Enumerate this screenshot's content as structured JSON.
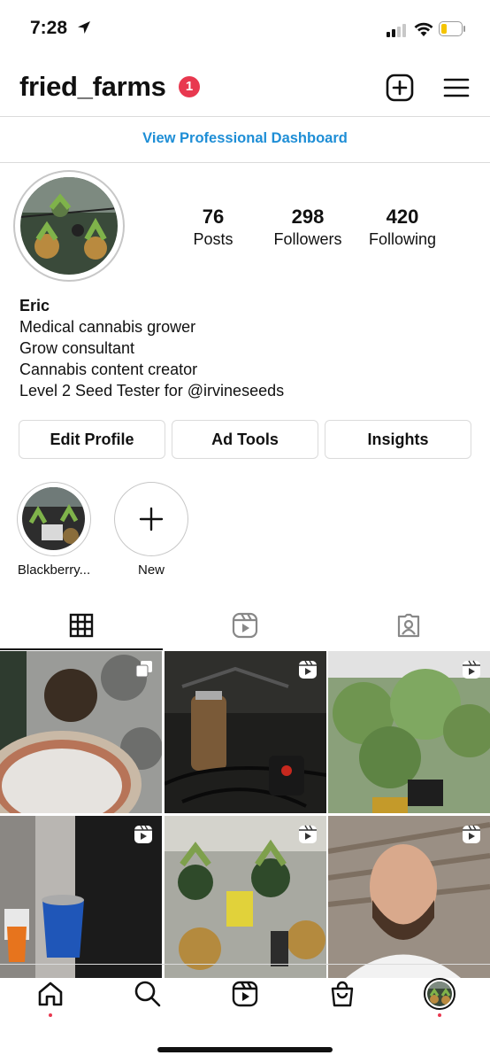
{
  "status": {
    "time": "7:28"
  },
  "header": {
    "username": "fried_farms",
    "notification_count": "1"
  },
  "dashboard_link": "View Professional Dashboard",
  "profile": {
    "stats": [
      {
        "value": "76",
        "label": "Posts"
      },
      {
        "value": "298",
        "label": "Followers"
      },
      {
        "value": "420",
        "label": "Following"
      }
    ],
    "name": "Eric",
    "bio_lines": [
      "Medical cannabis grower",
      "Grow consultant",
      "Cannabis content creator",
      "Level 2 Seed Tester for @irvineseeds"
    ],
    "buttons": [
      "Edit Profile",
      "Ad Tools",
      "Insights"
    ]
  },
  "highlights": [
    {
      "label": "Blackberry..."
    },
    {
      "label": "New"
    }
  ],
  "tabs": [
    "grid-icon",
    "reels-icon",
    "tagged-icon"
  ],
  "grid": [
    {
      "type": "carousel"
    },
    {
      "type": "reel"
    },
    {
      "type": "reel"
    },
    {
      "type": "reel"
    },
    {
      "type": "reel"
    },
    {
      "type": "reel"
    }
  ],
  "colors": {
    "accent_link": "#1e8ed6",
    "badge": "#e8384f"
  }
}
